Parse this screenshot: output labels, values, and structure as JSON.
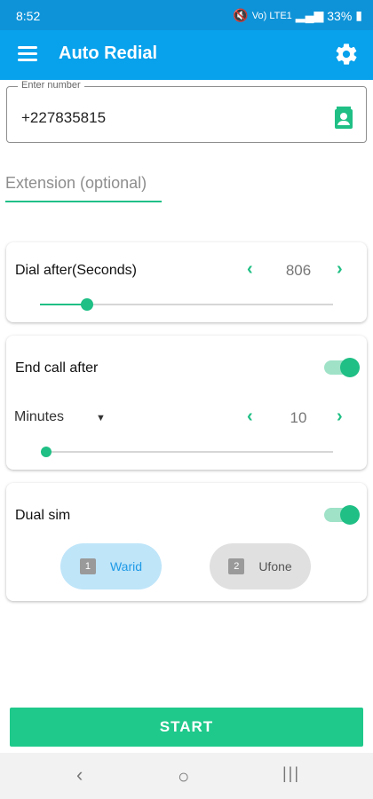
{
  "status_bar": {
    "time": "8:52",
    "network": "Vo) LTE1",
    "battery": "33%"
  },
  "app_bar": {
    "title": "Auto Redial",
    "menu_icon": "menu-icon",
    "settings_icon": "gear-icon"
  },
  "phone_field": {
    "label": "Enter number",
    "value": "+227835815",
    "contact_icon": "contact-book-icon"
  },
  "extension_field": {
    "placeholder": "Extension (optional)"
  },
  "dial_after": {
    "label": "Dial after(Seconds)",
    "value": "806",
    "slider_fraction": 0.16
  },
  "end_call_after": {
    "label": "End call after",
    "toggle_on": true,
    "unit": "Minutes",
    "value": "10",
    "slider_fraction": 0.0
  },
  "dual_sim": {
    "label": "Dual sim",
    "toggle_on": true,
    "sims": [
      {
        "badge": "1",
        "name": "Warid",
        "selected": true
      },
      {
        "badge": "2",
        "name": "Ufone",
        "selected": false
      }
    ]
  },
  "start_button": {
    "label": "START"
  },
  "accent_color": "#1fbf85",
  "appbar_color": "#07a1ec"
}
